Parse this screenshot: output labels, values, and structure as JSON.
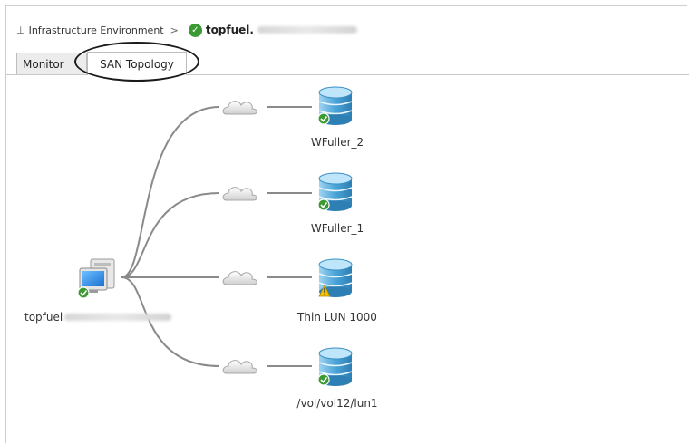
{
  "breadcrumb": {
    "root_icon": "tree-root-icon",
    "root_label": "Infrastructure Environment",
    "separator": ">",
    "status_icon": "ok-check-icon",
    "current": "topfuel."
  },
  "tabs": [
    {
      "label": "Monitor",
      "active": false
    },
    {
      "label": "SAN Topology",
      "active": true
    }
  ],
  "topology": {
    "host": {
      "label": "topfuel",
      "status": "ok",
      "icon": "computer-icon"
    },
    "luns": [
      {
        "label": "WFuller_2",
        "status": "ok",
        "icon": "storage-database-icon"
      },
      {
        "label": "WFuller_1",
        "status": "ok",
        "icon": "storage-database-icon"
      },
      {
        "label": "Thin LUN 1000",
        "status": "warning",
        "icon": "storage-database-icon"
      },
      {
        "label": "/vol/vol12/lun1",
        "status": "ok",
        "icon": "storage-database-icon"
      }
    ],
    "fabric_icon": "cloud-icon"
  },
  "colors": {
    "ok": "#3d9a32",
    "warning": "#f2c200",
    "storage": "#3a8fc4",
    "connector": "#8a8a8a",
    "callout": "#1a1a1a"
  }
}
